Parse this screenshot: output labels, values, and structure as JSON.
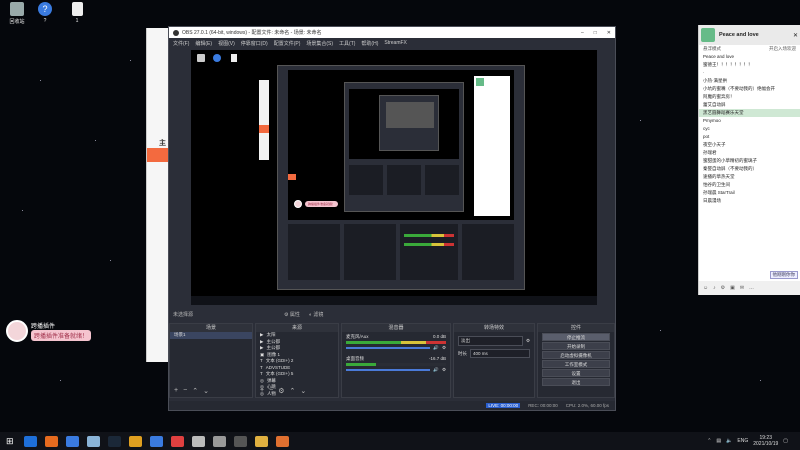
{
  "desktop": {
    "icons": [
      {
        "label": "回收站",
        "color": "#9aa"
      },
      {
        "label": "?",
        "color": "#3a7be0"
      },
      {
        "label": "1",
        "color": "#eee"
      }
    ]
  },
  "obs": {
    "title": "OBS 27.0.1 (64-bit, windows) - 配置文件: 未命名 - 场景: 未命名",
    "menu": [
      "文件(F)",
      "编辑(E)",
      "视图(V)",
      "停靠窗口(D)",
      "配置文件(P)",
      "场景集合(S)",
      "工具(T)",
      "帮助(H)",
      "StreamFX"
    ],
    "source_bar": {
      "label": "未选择源",
      "btn1": "属性",
      "btn2": "滤镜"
    },
    "panels": {
      "scenes": {
        "title": "场景",
        "items": [
          "场景1"
        ]
      },
      "sources": {
        "title": "来源",
        "items": [
          "太阳",
          "主公都",
          "主公都",
          "图像 1",
          "文本 (GDI+) 2",
          "ADVSTUDE",
          "文本 (GDI+) 5",
          "弹幕",
          "心跳",
          "人物"
        ]
      },
      "mixer": {
        "title": "混音器",
        "tracks": [
          {
            "name": "麦克风/Aux",
            "db": "0.0 dB"
          },
          {
            "name": "桌面音频",
            "db": "-16.7 dB"
          }
        ]
      },
      "transitions": {
        "title": "转场特效",
        "type": "淡出",
        "duration_label": "时长",
        "duration": "400 ms"
      },
      "controls": {
        "title": "控件",
        "buttons": [
          "停止推流",
          "开始录制",
          "启动虚拟摄像机",
          "工作室模式",
          "设置",
          "退出"
        ]
      }
    },
    "status": {
      "live": "LIVE: 00:00:00",
      "rec": "REC: 00:00:00",
      "cpu": "CPU: 2.0%, 60.00 fps"
    }
  },
  "overlay": {
    "name": "跨播插件",
    "status": "跨播插件准备就绪！"
  },
  "chat": {
    "title": "Peace and love",
    "sub_left": "悬浮模式",
    "sub_right": "开启入场欢迎",
    "rows": [
      "Peace and love",
      "蜜德王！！！！！！！！",
      "·",
      "小热·满星拱",
      "小坑的蜜嘴（不要动我的）绝幅会开",
      "阿魔的蜜奔房！",
      "蕾艾自动屏",
      "黑艺圆舞蹈赛乐天堂",
      "Pmymoo",
      "cyc",
      "pot",
      "夜空小天子",
      "孙瑞君",
      "蜜甜蛋的小草精初的蜜璃子",
      "秦婴自动屏（不要动我的）",
      "速播的草热天堂",
      "怕谷的卫生间",
      "孙瑞晨 StarTrail",
      "日晨漫场"
    ],
    "mini_btn": "他刚刚你你"
  },
  "taskbar": {
    "apps": [
      "#1e6fd9",
      "#e66b1f",
      "#3a7be0",
      "#8ab4d8",
      "#1b2838",
      "#e0a020",
      "#3a7be0",
      "#e04040",
      "#bbb",
      "#999",
      "#555",
      "#e0b040",
      "#e07030"
    ],
    "lang": "ENG",
    "time": "19:23",
    "date": "2021/10/19"
  }
}
